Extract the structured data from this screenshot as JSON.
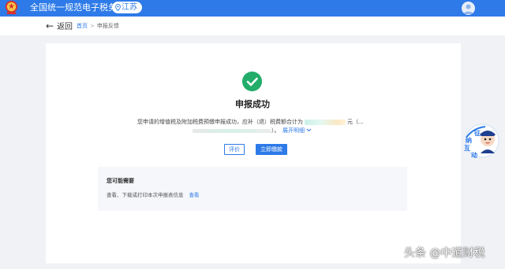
{
  "header": {
    "site_title": "全国统一规范电子税务局",
    "region": "江苏",
    "brand_color": "#2d7ae8"
  },
  "subbar": {
    "back_label": "返回",
    "breadcrumb": [
      "首页",
      "申报反馈"
    ]
  },
  "result": {
    "title": "申报成功",
    "message_prefix": "您申请的增值税及附加税费预缴申报成功，应补（退）税费额合计为",
    "message_suffix": "元（...",
    "message_line2_end": "）。",
    "expand_label": "展开明细",
    "success_color": "#22ad6a"
  },
  "actions": {
    "rate_label": "评价",
    "pay_label": "立即缴款"
  },
  "needs": {
    "title": "您可能需要",
    "text": "查看、下载或打印本次申报表信息",
    "link": "查看"
  },
  "widget": {
    "chars": [
      "征",
      "纳",
      "互",
      "动"
    ]
  },
  "watermark": "头条 @中道财税"
}
